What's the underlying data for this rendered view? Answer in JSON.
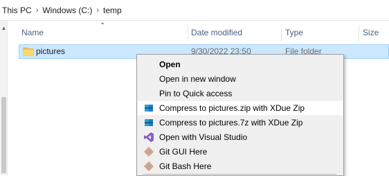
{
  "breadcrumb": {
    "items": [
      "This PC",
      "Windows (C:)",
      "temp"
    ],
    "separator": "›"
  },
  "columns": {
    "name": "Name",
    "date": "Date modified",
    "type": "Type",
    "size": "Size"
  },
  "rows": [
    {
      "name": "pictures",
      "date": "9/30/2022 23:50",
      "type": "File folder",
      "icon": "folder-icon"
    }
  ],
  "context_menu": {
    "items": [
      {
        "label": "Open",
        "bold": true,
        "icon": null
      },
      {
        "label": "Open in new window",
        "icon": null
      },
      {
        "label": "Pin to Quick access",
        "icon": null
      },
      {
        "label": "Compress to pictures.zip with XDue Zip",
        "icon": "xdue-zip-icon"
      },
      {
        "label": "Compress to pictures.7z with XDue Zip",
        "icon": "xdue-zip-icon"
      },
      {
        "label": "Open with Visual Studio",
        "icon": "visual-studio-icon"
      },
      {
        "label": "Git GUI Here",
        "icon": "git-gui-icon"
      },
      {
        "label": "Git Bash Here",
        "icon": "git-bash-icon"
      }
    ]
  },
  "colors": {
    "selection_bg": "#cce8ff",
    "selection_border": "#99d1ff",
    "menu_bg": "#f0f0f0",
    "menu_highlight": "#ffffff",
    "header_text": "#4d6082"
  }
}
